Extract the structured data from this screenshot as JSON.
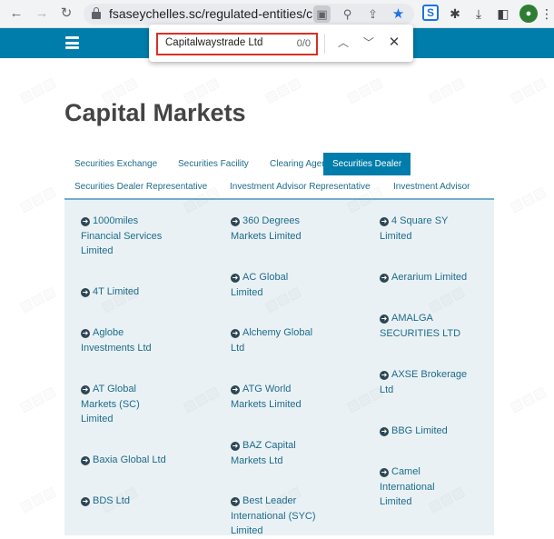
{
  "browser": {
    "url": "fsaseychelles.sc/regulated-entities/c...",
    "icons": [
      "back-icon",
      "forward-icon",
      "reload-icon",
      "lock-icon",
      "find-icon",
      "zoom-icon",
      "share-icon",
      "star-icon",
      "extension-s-icon",
      "puzzle-icon",
      "download-icon",
      "sidebar-icon",
      "profile-icon",
      "menu-icon"
    ]
  },
  "findbar": {
    "query": "Capitalwaystrade Ltd",
    "count": "0/0"
  },
  "page": {
    "title": "Capital Markets",
    "accent_color": "#007daa",
    "tabs": [
      {
        "label": "Securities Exchange"
      },
      {
        "label": "Securities Facility"
      },
      {
        "label": "Clearing Agency"
      },
      {
        "label": "Securities Dealer"
      },
      {
        "label": "Securities Dealer Representative"
      },
      {
        "label": "Investment Advisor Representative"
      },
      {
        "label": "Investment Advisor"
      }
    ],
    "active_tab": "Securities Dealer",
    "entities": [
      [
        "1000miles",
        "Financial Services",
        "Limited"
      ],
      [
        "360 Degrees",
        "Markets Limited"
      ],
      [
        "4 Square SY",
        "Limited"
      ],
      [
        "AC Global",
        "Limited"
      ],
      [
        "4T Limited"
      ],
      [
        "Aerarium Limited"
      ],
      [
        "AMALGA",
        "SECURITIES LTD"
      ],
      [
        "Aglobe",
        "Investments Ltd"
      ],
      [
        "Alchemy Global",
        "Ltd"
      ],
      [
        "AXSE Brokerage",
        "Ltd"
      ],
      [
        "AT Global",
        "Markets (SC)",
        "Limited"
      ],
      [
        "ATG World",
        "Markets Limited"
      ],
      [
        "BBG Limited"
      ],
      [
        "BAZ Capital",
        "Markets Ltd"
      ],
      [
        "Baxia Global Ltd"
      ],
      [
        "Camel",
        "International",
        "Limited"
      ],
      [
        "BDS Ltd"
      ],
      [
        "Best Leader",
        "International (SYC)",
        "Limited"
      ]
    ]
  }
}
